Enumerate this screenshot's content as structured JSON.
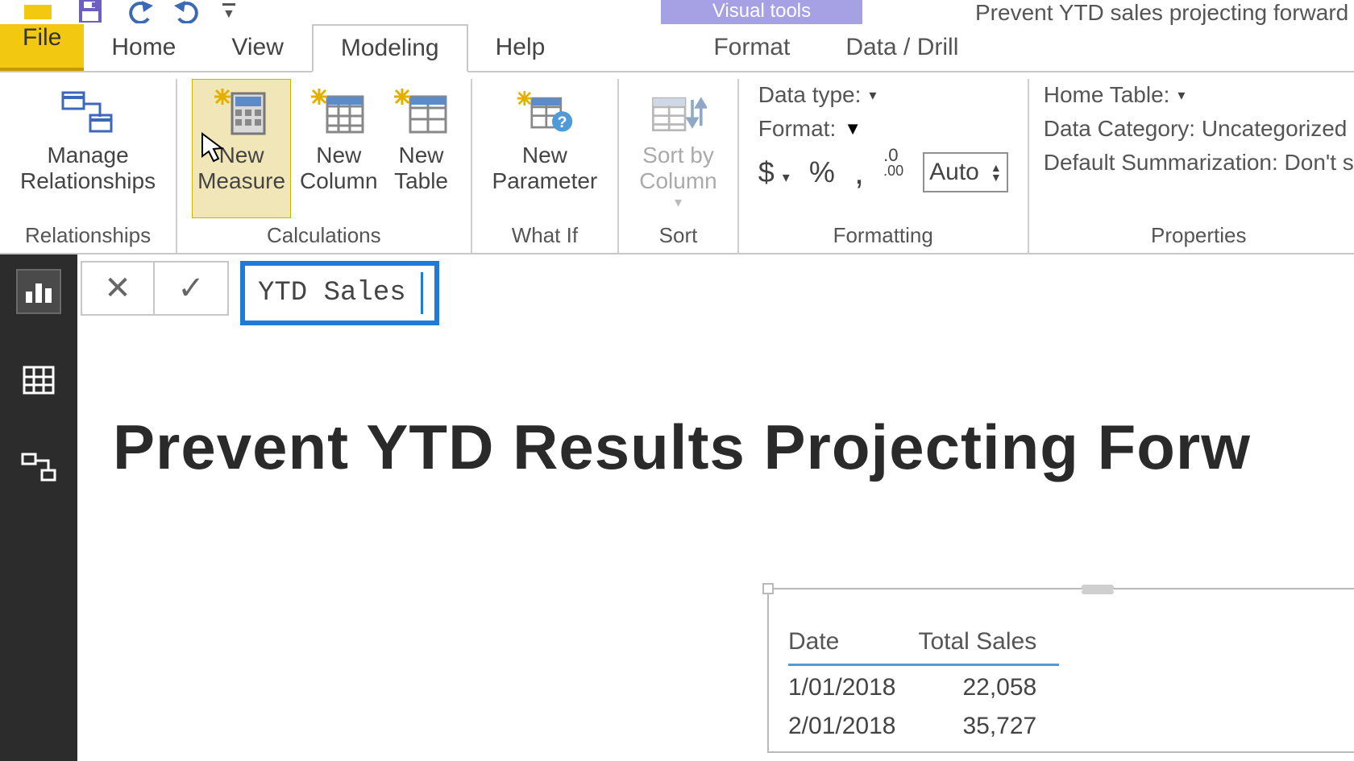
{
  "titlebar": {
    "context_tab_label": "Visual tools",
    "document_title": "Prevent YTD sales projecting forward"
  },
  "tabs": {
    "file": "File",
    "home": "Home",
    "view": "View",
    "modeling": "Modeling",
    "help": "Help",
    "format": "Format",
    "data_drill": "Data / Drill"
  },
  "ribbon": {
    "relationships": {
      "manage_label": "Manage\nRelationships",
      "group_label": "Relationships"
    },
    "calculations": {
      "new_measure": "New\nMeasure",
      "new_column": "New\nColumn",
      "new_table": "New\nTable",
      "group_label": "Calculations"
    },
    "whatif": {
      "new_parameter": "New\nParameter",
      "group_label": "What If"
    },
    "sort": {
      "sort_by_column": "Sort by\nColumn",
      "group_label": "Sort"
    },
    "formatting": {
      "data_type_label": "Data type:",
      "format_label": "Format:",
      "auto_label": "Auto",
      "group_label": "Formatting"
    },
    "properties": {
      "home_table_label": "Home Table:",
      "data_category_label": "Data Category: Uncategorized",
      "default_summ_label": "Default Summarization: Don't s",
      "group_label": "Properties"
    }
  },
  "formula": {
    "expression": "YTD Sales ="
  },
  "canvas": {
    "page_title": "Prevent YTD Results Projecting Forw"
  },
  "table_visual": {
    "columns": [
      "Date",
      "Total Sales"
    ],
    "rows": [
      {
        "date": "1/01/2018",
        "total": "22,058"
      },
      {
        "date": "2/01/2018",
        "total": "35,727"
      }
    ]
  }
}
